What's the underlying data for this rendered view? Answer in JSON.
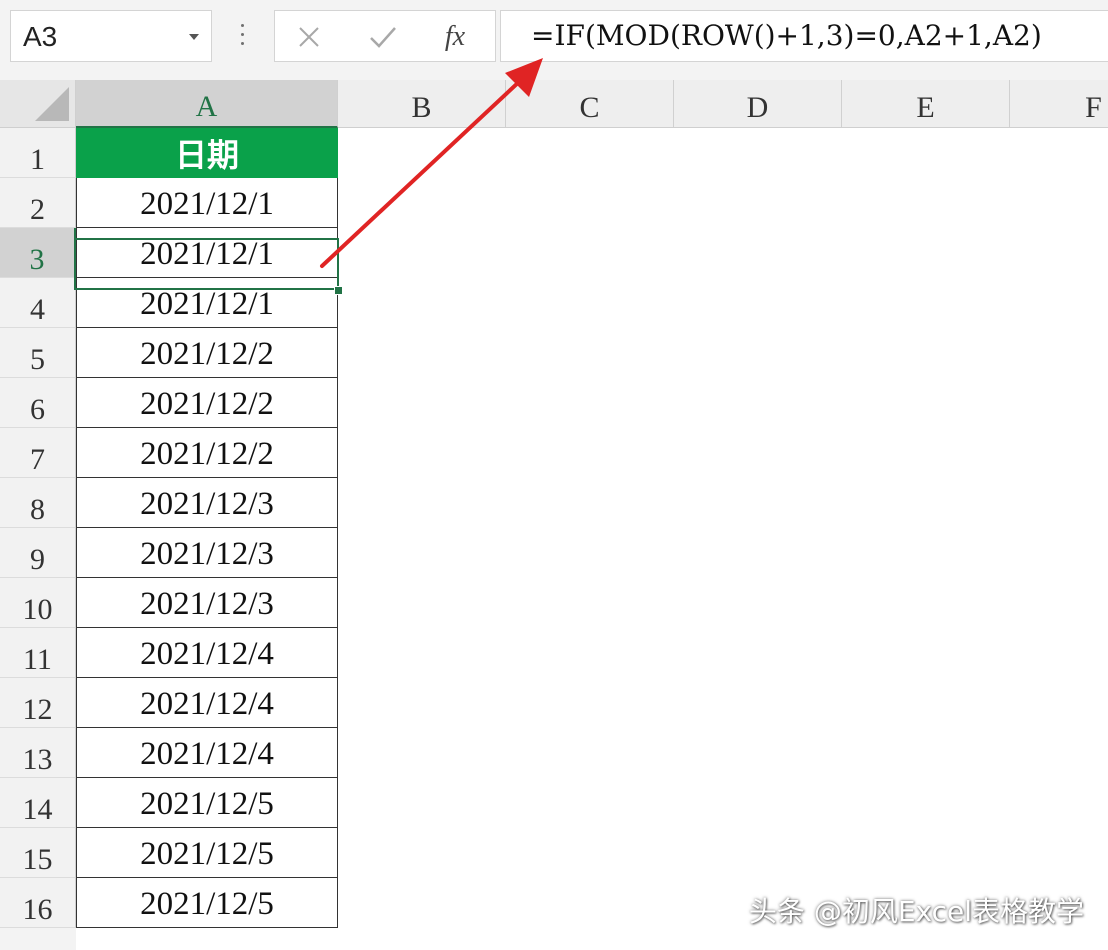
{
  "formula_bar": {
    "name_box": "A3",
    "cancel_icon": "close-icon",
    "enter_icon": "check-icon",
    "fx_label": "fx",
    "formula": "=IF(MOD(ROW()+1,3)=0,A2+1,A2)"
  },
  "columns": [
    "A",
    "B",
    "C",
    "D",
    "E",
    "F"
  ],
  "rows": [
    "1",
    "2",
    "3",
    "4",
    "5",
    "6",
    "7",
    "8",
    "9",
    "10",
    "11",
    "12",
    "13",
    "14",
    "15",
    "16"
  ],
  "selected_cell": "A3",
  "cells": {
    "header": "日期",
    "values": [
      "2021/12/1",
      "2021/12/1",
      "2021/12/1",
      "2021/12/2",
      "2021/12/2",
      "2021/12/2",
      "2021/12/3",
      "2021/12/3",
      "2021/12/3",
      "2021/12/4",
      "2021/12/4",
      "2021/12/4",
      "2021/12/5",
      "2021/12/5",
      "2021/12/5"
    ]
  },
  "watermark": "头条 @初风Excel表格教学",
  "colors": {
    "header_fill": "#0aa14a",
    "selection": "#217346",
    "arrow": "#e02424"
  }
}
